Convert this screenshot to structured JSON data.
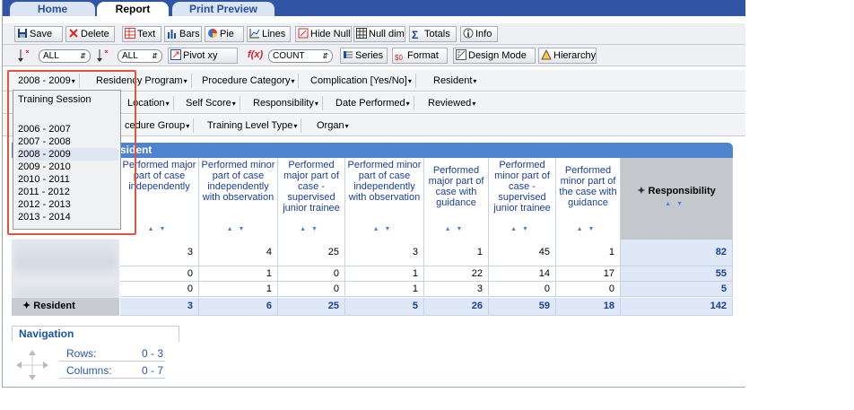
{
  "tabs": [
    {
      "label": "Home",
      "active": false
    },
    {
      "label": "Report",
      "active": true
    },
    {
      "label": "Print Preview",
      "active": false
    }
  ],
  "toolbar1": {
    "save": "Save",
    "delete": "Delete",
    "text": "Text",
    "bars": "Bars",
    "pie": "Pie",
    "lines": "Lines",
    "hide_null": "Hide Null",
    "null_dim": "Null dim",
    "totals": "Totals",
    "info": "Info"
  },
  "toolbar2": {
    "sel1": "ALL",
    "sel2": "ALL",
    "pivot": "Pivot xy",
    "fx": "f(x)",
    "count": "COUNT",
    "series": "Series",
    "format": "Format",
    "design_mode": "Design Mode",
    "hierarchy": "Hierarchy"
  },
  "filters_row1": [
    "2008 - 2009",
    "Residency Program",
    "Procedure Category",
    "Complication [Yes/No]",
    "Resident"
  ],
  "filters_row2": [
    "Location",
    "Self Score",
    "Responsibility",
    "Date Performed",
    "Reviewed"
  ],
  "filters_row3": [
    "cedure Group",
    "Training Level Type",
    "Organ"
  ],
  "dropdown": {
    "header": "Training Session",
    "options": [
      "2006 - 2007",
      "2007 - 2008",
      "2008 - 2009",
      "2009 - 2010",
      "2010 - 2011",
      "2011 - 2012",
      "2012 - 2013",
      "2013 - 2014"
    ],
    "selected": "2008 - 2009"
  },
  "grid": {
    "title": "sident",
    "columns": [
      "Performed major part of case independently",
      "Performed minor part of case independently with observation",
      "Performed major part of case - supervised junior trainee",
      "Performed minor part of case independently with observation",
      "Performed major part of case with guidance",
      "Performed minor part of case - supervised junior trainee",
      "Performed minor part of the case with guidance"
    ],
    "total_column": "Responsibility",
    "rows": [
      [
        "3",
        "4",
        "25",
        "3",
        "1",
        "45",
        "1",
        "82"
      ],
      [
        "0",
        "1",
        "0",
        "1",
        "22",
        "14",
        "17",
        "55"
      ],
      [
        "0",
        "1",
        "0",
        "1",
        "3",
        "0",
        "0",
        "5"
      ]
    ],
    "total_row_label": "Resident",
    "totals": [
      "3",
      "6",
      "25",
      "5",
      "26",
      "59",
      "18",
      "142"
    ]
  },
  "navigation": {
    "title": "Navigation",
    "rows_label": "Rows:",
    "rows_value": "0 - 3",
    "columns_label": "Columns:",
    "columns_value": "0 - 7"
  }
}
